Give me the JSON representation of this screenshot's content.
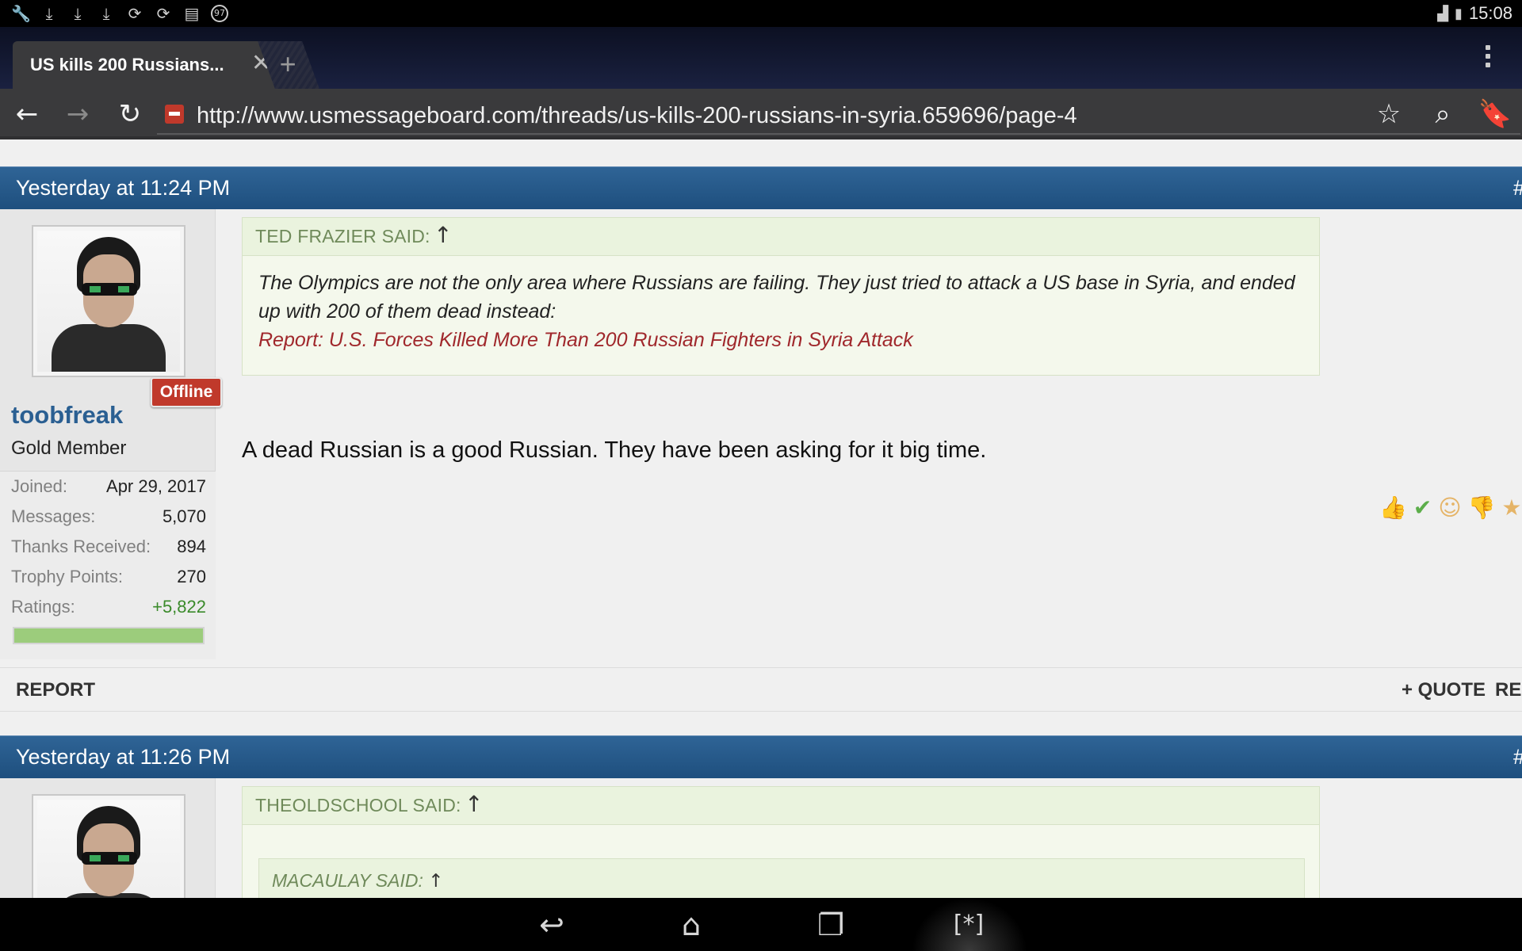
{
  "status_bar": {
    "time": "15:08",
    "notification_icons": [
      "wrench-icon",
      "download-icon",
      "download-icon",
      "download-icon",
      "sync-icon",
      "sync-icon",
      "message-icon",
      "badge-icon"
    ],
    "notification_badge": "97"
  },
  "browser": {
    "tab_title": "US kills 200 Russians...",
    "close_glyph": "✕",
    "new_tab_glyph": "+",
    "url": "http://www.usmessageboard.com/threads/us-kills-200-russians-in-syria.659696/page-4"
  },
  "posts": [
    {
      "date": "Yesterday at 11:24 PM",
      "permalink": "#",
      "offline_label": "Offline",
      "username": "toobfreak",
      "user_title": "Gold Member",
      "stats": [
        {
          "label": "Joined:",
          "value": "Apr 29, 2017"
        },
        {
          "label": "Messages:",
          "value": "5,070"
        },
        {
          "label": "Thanks Received:",
          "value": "894"
        },
        {
          "label": "Trophy Points:",
          "value": "270"
        },
        {
          "label": "Ratings:",
          "value": "+5,822"
        }
      ],
      "rating_fill": 1.0,
      "quote_author": "TED FRAZIER SAID:",
      "quote_text": "The Olympics are not the only area where Russians are failing. They just tried to attack a US base in Syria, and ended up with 200 of them dead instead:",
      "quote_link": "Report: U.S. Forces Killed More Than 200 Russian Fighters in Syria Attack",
      "message": "A dead Russian is a good Russian. They have been asking for it big time.",
      "report_label": "REPORT",
      "quote_action": "+ QUOTE",
      "reply_action": "REI"
    },
    {
      "date": "Yesterday at 11:26 PM",
      "permalink": "#",
      "quote_author": "THEOLDSCHOOL SAID:",
      "nested_quote_author": "MACAULAY SAID:"
    }
  ],
  "quote_arrow_glyph": "↑",
  "colors": {
    "header_blue": "#2f6496",
    "username_blue": "#2a5f92",
    "offline_red": "#c0392b",
    "quote_link_red": "#a0282c",
    "rating_green": "#3a8a2a"
  }
}
